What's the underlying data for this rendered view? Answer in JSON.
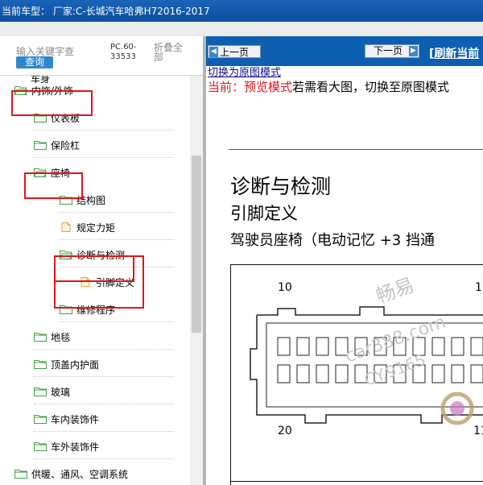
{
  "title_bar": {
    "text": "当前车型： 厂家:C-长城汽车哈弗H72016-2017"
  },
  "search": {
    "placeholder": "输入关键字查",
    "query_button": "查询",
    "code": "PC.60-33533",
    "collapse_all": "折叠全部"
  },
  "tree": {
    "partial_top": "车身",
    "items": [
      {
        "label": "内饰/外饰",
        "icon": "folder-open-icon"
      },
      {
        "label": "仪表板",
        "icon": "folder-icon"
      },
      {
        "label": "保险杠",
        "icon": "folder-icon"
      },
      {
        "label": "座椅",
        "icon": "folder-open-icon"
      },
      {
        "label": "结构图",
        "icon": "folder-icon"
      },
      {
        "label": "规定力矩",
        "icon": "document-icon"
      },
      {
        "label": "诊断与检测",
        "icon": "folder-open-icon"
      },
      {
        "label": "引脚定义",
        "icon": "document-icon"
      },
      {
        "label": "维修程序",
        "icon": "folder-icon"
      },
      {
        "label": "地毯",
        "icon": "folder-icon"
      },
      {
        "label": "顶盖内护面",
        "icon": "folder-icon"
      },
      {
        "label": "玻璃",
        "icon": "folder-icon"
      },
      {
        "label": "车内装饰件",
        "icon": "folder-icon"
      },
      {
        "label": "车外装饰件",
        "icon": "folder-icon"
      },
      {
        "label": "供暖、通风、空调系统",
        "icon": "folder-icon"
      }
    ]
  },
  "nav": {
    "prev_button": "上一页",
    "next_button": "下一页",
    "refresh_link": "刷新当前"
  },
  "content": {
    "switch_link": "切换为原图模式",
    "current_prefix": "当前：预览模式",
    "current_suffix": "若需看大图，切换至原图模式",
    "heading": "诊断与检测",
    "subheading": "引脚定义",
    "caption": "驾驶员座椅（电动记忆 +3  挡通",
    "pin_top_left": "10",
    "pin_top_right": "1",
    "pin_bottom_left": "20",
    "pin_bottom_right": "11"
  },
  "watermark": {
    "line1": "畅易",
    "line2": "car388.com",
    "line3": "CY.9165"
  },
  "colors": {
    "title_bar": "#0b4f9f",
    "nav_bar": "#0d5fb0",
    "highlight": "#e0161c",
    "folder": "#5cb85c",
    "query_button": "#2f87cf"
  }
}
